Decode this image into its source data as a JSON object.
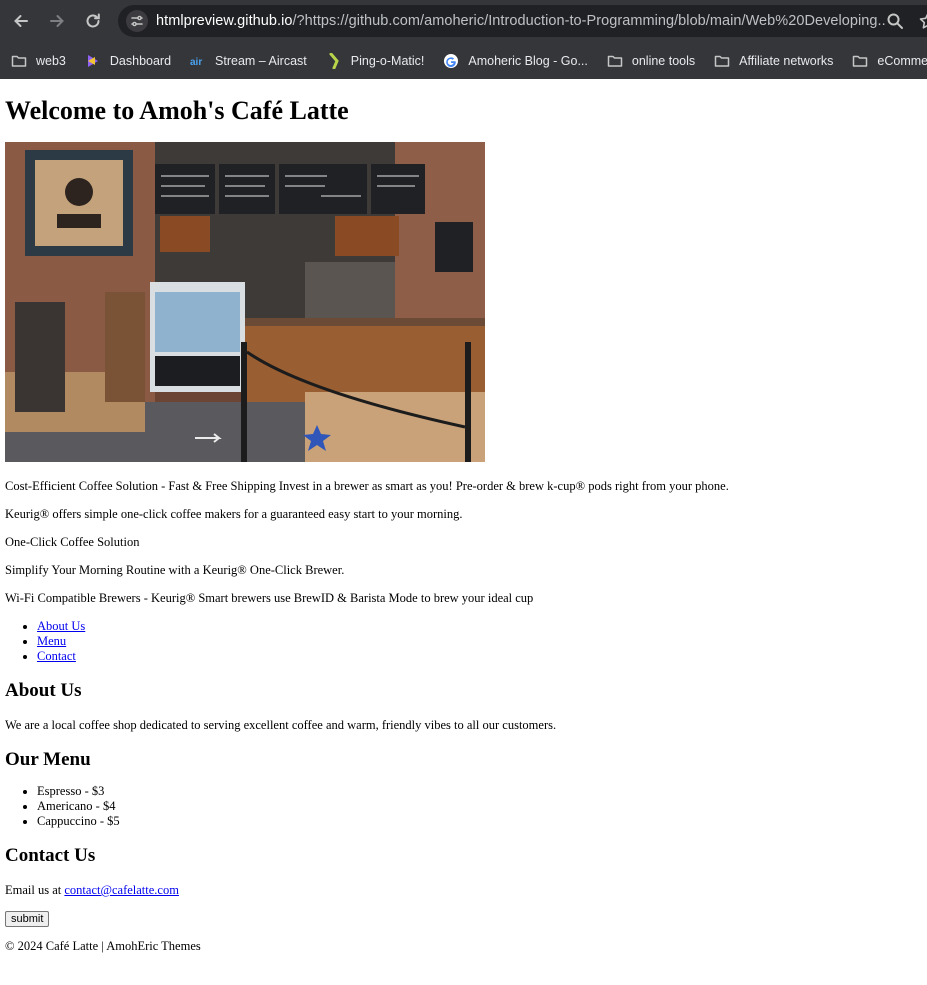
{
  "browser": {
    "url_host": "htmlpreview.github.io",
    "url_rest": "/?https://github.com/amoheric/Introduction-to-Programming/blob/main/Web%20Developing...",
    "bookmarks": [
      {
        "label": "web3",
        "icon": "folder-icon"
      },
      {
        "label": "Dashboard",
        "icon": "dashboard-favicon"
      },
      {
        "label": "Stream – Aircast",
        "icon": "aircast-favicon"
      },
      {
        "label": "Ping-o-Matic!",
        "icon": "pingomatic-favicon"
      },
      {
        "label": "Amoheric Blog - Go...",
        "icon": "google-favicon"
      },
      {
        "label": "online tools",
        "icon": "folder-icon"
      },
      {
        "label": "Affiliate networks",
        "icon": "folder-icon"
      },
      {
        "label": "eCommerce",
        "icon": "folder-icon"
      }
    ]
  },
  "page": {
    "title": "Welcome to Amoh's Café Latte",
    "paragraphs": [
      "Cost-Efficient Coffee Solution - Fast & Free Shipping Invest in a brewer as smart as you! Pre-order & brew k-cup® pods right from your phone.",
      "Keurig® offers simple one-click coffee makers for a guaranteed easy start to your morning.",
      "One-Click Coffee Solution",
      "Simplify Your Morning Routine with a Keurig® One-Click Brewer.",
      "Wi-Fi Compatible Brewers - Keurig® Smart brewers use BrewID & Barista Mode to brew your ideal cup"
    ],
    "nav": [
      "About Us",
      "Menu",
      "Contact"
    ],
    "about": {
      "heading": "About Us",
      "text": "We are a local coffee shop dedicated to serving excellent coffee and warm, friendly vibes to all our customers."
    },
    "menu": {
      "heading": "Our Menu",
      "items": [
        "Espresso - $3",
        "Americano - $4",
        "Cappuccino - $5"
      ]
    },
    "contact": {
      "heading": "Contact Us",
      "prefix": "Email us at ",
      "email": "contact@cafelatte.com",
      "submit_label": "submit"
    },
    "footer": "© 2024 Café Latte | AmohEric Themes"
  }
}
